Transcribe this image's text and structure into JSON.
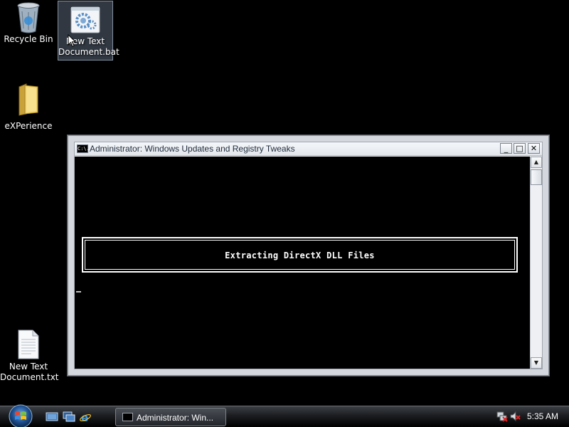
{
  "desktop": {
    "icons": [
      {
        "label": "Recycle Bin",
        "icon": "recycle-bin-icon"
      },
      {
        "label": "New Text\nDocument.bat",
        "icon": "batch-file-gear-icon",
        "selected": true
      },
      {
        "label": "eXPerience",
        "icon": "folder-icon"
      },
      {
        "label": "New Text\nDocument.txt",
        "icon": "text-document-icon"
      }
    ]
  },
  "console": {
    "title": "Administrator:  Windows Updates and Registry Tweaks",
    "icon_label": "C:\\.",
    "buttons": {
      "minimize": "_",
      "maximize": "□",
      "close": "✕"
    },
    "message": "Extracting DirectX DLL Files",
    "background": "#000000",
    "text_color": "#FFFFFF"
  },
  "taskbar": {
    "task_button_label": "Administrator:  Win...",
    "clock": "5:35 AM",
    "quick_launch": [
      "show-desktop-icon",
      "switch-windows-icon",
      "internet-explorer-icon"
    ],
    "tray": [
      "network-disconnected-icon",
      "volume-muted-icon"
    ]
  }
}
